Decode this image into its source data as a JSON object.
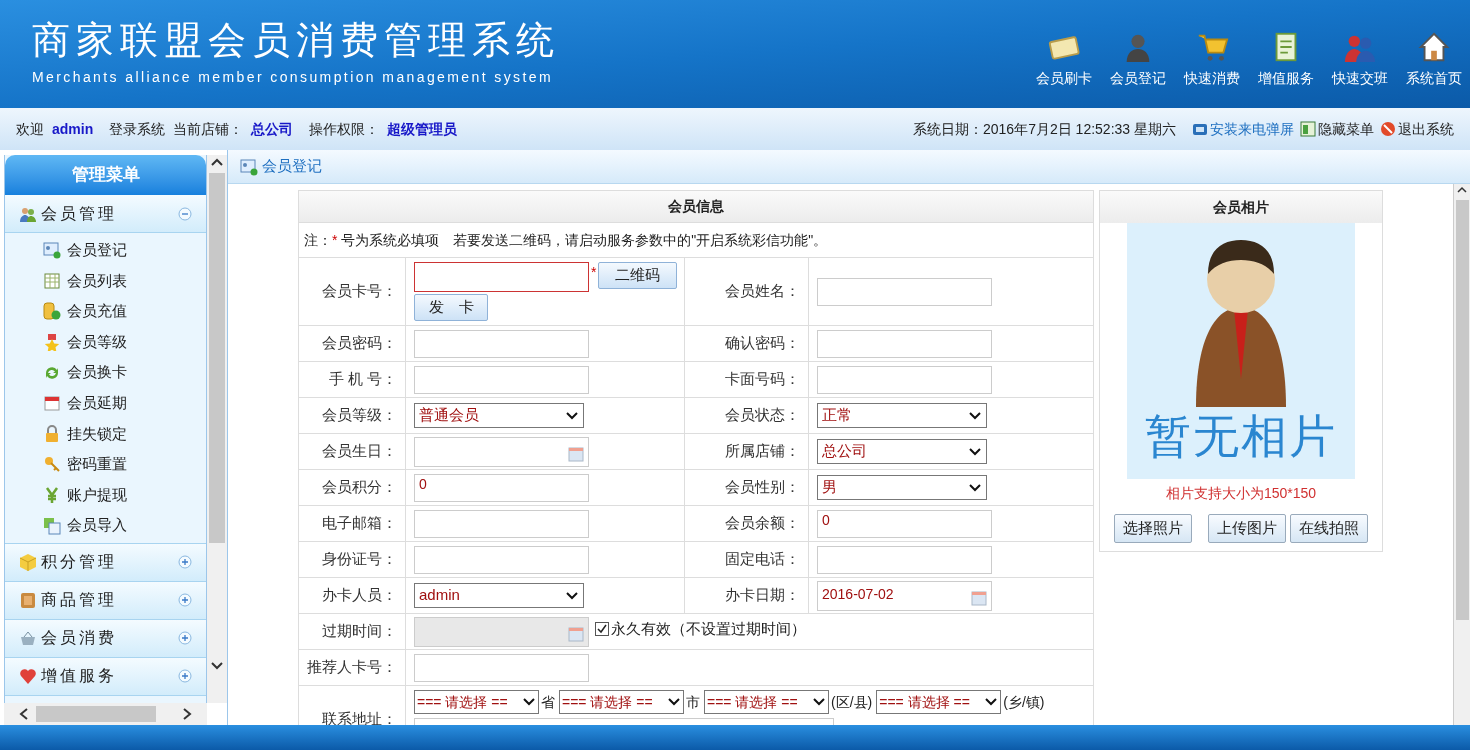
{
  "header": {
    "title": "商家联盟会员消费管理系统",
    "subtitle": "Merchants alliance member consumption management system",
    "nav": [
      {
        "label": "会员刷卡"
      },
      {
        "label": "会员登记"
      },
      {
        "label": "快速消费"
      },
      {
        "label": "增值服务"
      },
      {
        "label": "快速交班"
      },
      {
        "label": "系统首页"
      }
    ]
  },
  "info_bar": {
    "items": [
      {
        "text": "欢迎",
        "kind": "label"
      },
      {
        "text": "admin",
        "kind": "value"
      },
      {
        "text": "登录系统",
        "kind": "label"
      },
      {
        "text": "当前店铺：",
        "kind": "label"
      },
      {
        "text": "总公司",
        "kind": "value"
      },
      {
        "text": "操作权限：",
        "kind": "label"
      },
      {
        "text": "超级管理员",
        "kind": "value"
      }
    ],
    "date": "系统日期：2016年7月2日 12:52:33 星期六",
    "links": [
      {
        "label": "安装来电弹屏",
        "kind": "phone"
      },
      {
        "label": "隐藏菜单",
        "kind": "menu"
      },
      {
        "label": "退出系统",
        "kind": "exit"
      }
    ]
  },
  "sidebar": {
    "title": "管理菜单",
    "groups": [
      {
        "label": "会员管理",
        "expanded": true,
        "children": [
          {
            "label": "会员登记"
          },
          {
            "label": "会员列表"
          },
          {
            "label": "会员充值"
          },
          {
            "label": "会员等级"
          },
          {
            "label": "会员换卡"
          },
          {
            "label": "会员延期"
          },
          {
            "label": "挂失锁定"
          },
          {
            "label": "密码重置"
          },
          {
            "label": "账户提现"
          },
          {
            "label": "会员导入"
          }
        ]
      },
      {
        "label": "积分管理",
        "expanded": false
      },
      {
        "label": "商品管理",
        "expanded": false
      },
      {
        "label": "会员消费",
        "expanded": false
      },
      {
        "label": "增值服务",
        "expanded": false
      }
    ]
  },
  "breadcrumb": "会员登记",
  "form": {
    "title": "会员信息",
    "note_prefix": "注：",
    "required_mark": "*",
    "note": "号为系统必填项　若要发送二维码，请启动服务参数中的\"开启系统彩信功能\"。",
    "rows": [
      {
        "cells": [
          {
            "label": "会员卡号：",
            "field": {
              "kind": "card",
              "required": true,
              "buttons": [
                "二维码",
                "发　卡"
              ]
            }
          },
          {
            "label": "会员姓名：",
            "field": {
              "kind": "text"
            }
          }
        ]
      },
      {
        "cells": [
          {
            "label": "会员密码：",
            "field": {
              "kind": "text"
            }
          },
          {
            "label": "确认密码：",
            "field": {
              "kind": "text"
            }
          }
        ]
      },
      {
        "cells": [
          {
            "label": "手 机 号：",
            "field": {
              "kind": "text"
            }
          },
          {
            "label": "卡面号码：",
            "field": {
              "kind": "text"
            }
          }
        ]
      },
      {
        "cells": [
          {
            "label": "会员等级：",
            "field": {
              "kind": "select",
              "value": "普通会员"
            }
          },
          {
            "label": "会员状态：",
            "field": {
              "kind": "select",
              "value": "正常"
            }
          }
        ]
      },
      {
        "cells": [
          {
            "label": "会员生日：",
            "field": {
              "kind": "date",
              "disabled": false
            }
          },
          {
            "label": "所属店铺：",
            "field": {
              "kind": "select",
              "value": "总公司"
            }
          }
        ]
      },
      {
        "cells": [
          {
            "label": "会员积分：",
            "field": {
              "kind": "text",
              "value": "0"
            }
          },
          {
            "label": "会员性别：",
            "field": {
              "kind": "select",
              "value": "男"
            }
          }
        ]
      },
      {
        "cells": [
          {
            "label": "电子邮箱：",
            "field": {
              "kind": "text"
            }
          },
          {
            "label": "会员余额：",
            "field": {
              "kind": "text",
              "value": "0"
            }
          }
        ]
      },
      {
        "cells": [
          {
            "label": "身份证号：",
            "field": {
              "kind": "text"
            }
          },
          {
            "label": "固定电话：",
            "field": {
              "kind": "text"
            }
          }
        ]
      },
      {
        "cells": [
          {
            "label": "办卡人员：",
            "field": {
              "kind": "select",
              "value": "admin"
            }
          },
          {
            "label": "办卡日期：",
            "field": {
              "kind": "date",
              "disabled": false,
              "value": "2016-07-02"
            }
          }
        ]
      },
      {
        "cells": [
          {
            "label": "过期时间：",
            "field": {
              "kind": "date",
              "disabled": true
            },
            "checkbox": {
              "label": "永久有效（不设置过期时间）",
              "checked": true
            }
          }
        ]
      },
      {
        "cells": [
          {
            "label": "推荐人卡号：",
            "field": {
              "kind": "text"
            }
          }
        ]
      },
      {
        "cells": [
          {
            "label": "联系地址：",
            "field": {
              "kind": "address",
              "selects": [
                {
                  "value": "=== 请选择 ==",
                  "suffix": "省"
                },
                {
                  "value": "=== 请选择 ==",
                  "suffix": "市"
                },
                {
                  "value": "=== 请选择 ==",
                  "suffix": "(区/县)"
                },
                {
                  "value": "=== 请选择 ==",
                  "suffix": "(乡/镇)"
                }
              ]
            }
          }
        ]
      }
    ]
  },
  "photo": {
    "title": "会员相片",
    "placeholder_text": "暂无相片",
    "hint": "相片支持大小为150*150",
    "buttons": [
      "选择照片",
      "上传图片",
      "在线拍照"
    ]
  }
}
